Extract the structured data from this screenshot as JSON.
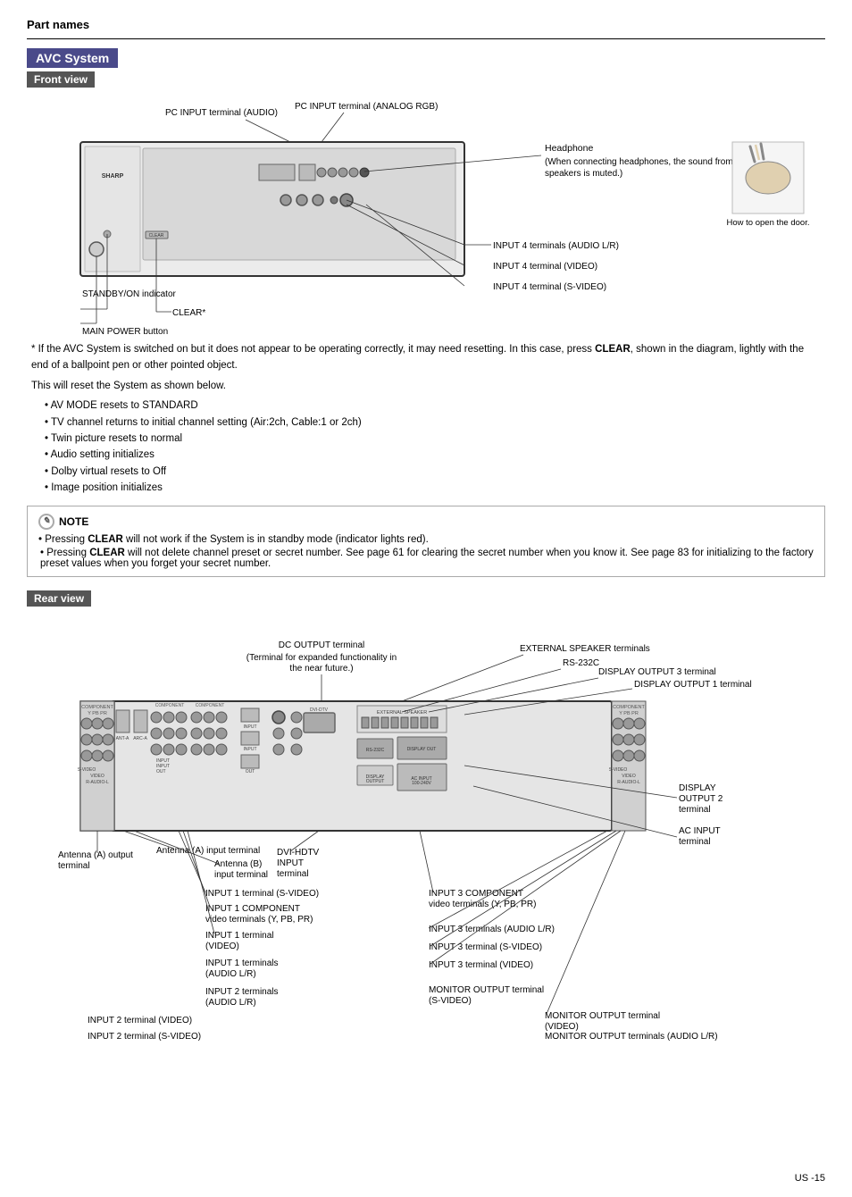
{
  "page": {
    "section_title": "Part names",
    "avc_badge": "AVC System",
    "front_view_badge": "Front view",
    "rear_view_badge": "Rear view",
    "page_number": "-15",
    "region_code": "US"
  },
  "front_labels": {
    "pc_input_audio": "PC INPUT terminal (AUDIO)",
    "pc_input_analog": "PC INPUT terminal (ANALOG RGB)",
    "headphone_title": "Headphone",
    "headphone_desc": "(When connecting headphones, the sound from the speakers is muted.)",
    "standby_on": "STANDBY/ON indicator",
    "clear_label": "CLEAR*",
    "main_power": "MAIN POWER button",
    "input4_audio": "INPUT 4 terminals (AUDIO L/R)",
    "input4_video": "INPUT 4 terminal (VIDEO)",
    "input4_svideo": "INPUT 4 terminal (S-VIDEO)",
    "door_label": "How to open the door."
  },
  "asterisk_note": {
    "intro": "* If the AVC System is switched on but it does not appear to be operating correctly, it may need resetting. In this case, press",
    "clear_word": "CLEAR",
    "middle": ", shown in the diagram, lightly with the end of a ballpoint pen or other pointed object.",
    "second_line": "This will reset the System as shown below.",
    "bullets": [
      "AV MODE resets to STANDARD",
      "TV channel returns to initial channel setting (Air:2ch, Cable:1 or 2ch)",
      "Twin picture resets to normal",
      "Audio setting initializes",
      "Dolby virtual resets to Off",
      "Image position initializes"
    ]
  },
  "note_box": {
    "header": "NOTE",
    "lines": [
      {
        "prefix": "Pressing",
        "bold": "CLEAR",
        "suffix": "will not work if the System is in standby mode (indicator lights red)."
      },
      {
        "prefix": "Pressing",
        "bold": "CLEAR",
        "suffix": "will not delete channel preset or secret number. See page 61 for clearing the secret number when you know it. See page 83 for initializing to the factory preset values when you forget your secret number."
      }
    ]
  },
  "rear_labels": {
    "dc_output": "DC OUTPUT terminal",
    "dc_output_desc": "(Terminal for expanded functionality in the near future.)",
    "ext_speaker": "EXTERNAL SPEAKER terminals",
    "rs232c": "RS-232C",
    "display_out3": "DISPLAY OUTPUT 3 terminal",
    "display_out1": "DISPLAY OUTPUT 1 terminal",
    "display_out2": "DISPLAY OUTPUT 2 terminal",
    "ac_input": "AC INPUT terminal",
    "antenna_a_out": "Antenna (A) output terminal",
    "antenna_a_in": "Antenna (A) input terminal",
    "antenna_b_in": "Antenna (B) input terminal",
    "dvi_hdtv": "DVI-HDTV INPUT terminal",
    "input1_svideo": "INPUT 1 terminal (S-VIDEO)",
    "input1_component": "INPUT 1 COMPONENT video terminals (Y, PB, PR)",
    "input1_video": "INPUT 1 terminal (VIDEO)",
    "input1_audio": "INPUT 1 terminals (AUDIO L/R)",
    "input2_audio": "INPUT 2 terminals (AUDIO L/R)",
    "input2_video": "INPUT 2 terminal (VIDEO)",
    "input2_svideo": "INPUT 2 terminal (S-VIDEO)",
    "input3_component": "INPUT 3 COMPONENT video terminals (Y, PB, PR)",
    "input3_audio": "INPUT 3 terminals (AUDIO L/R)",
    "input3_svideo": "INPUT 3 terminal (S-VIDEO)",
    "input3_video": "INPUT 3 terminal (VIDEO)",
    "monitor_svideo": "MONITOR OUTPUT terminal (S-VIDEO)",
    "monitor_video": "MONITOR OUTPUT terminal (VIDEO)",
    "monitor_audio": "MONITOR OUTPUT terminals (AUDIO L/R)"
  }
}
